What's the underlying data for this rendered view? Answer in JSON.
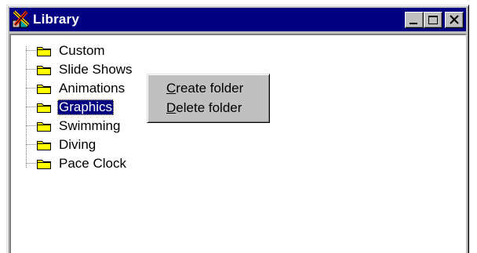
{
  "window": {
    "title": "Library",
    "app_icon": "library-app-icon",
    "buttons": [
      "minimize-icon",
      "maximize-icon",
      "close-icon"
    ]
  },
  "tree": {
    "items": [
      {
        "label": "Custom",
        "icon": "folder-icon",
        "selected": false
      },
      {
        "label": "Slide Shows",
        "icon": "folder-icon",
        "selected": false
      },
      {
        "label": "Animations",
        "icon": "folder-icon",
        "selected": false
      },
      {
        "label": "Graphics",
        "icon": "folder-icon",
        "selected": true
      },
      {
        "label": "Swimming",
        "icon": "folder-icon",
        "selected": false
      },
      {
        "label": "Diving",
        "icon": "folder-icon",
        "selected": false
      },
      {
        "label": "Pace Clock",
        "icon": "folder-icon",
        "selected": false
      }
    ]
  },
  "context_menu": {
    "items": [
      {
        "accel": "C",
        "rest": "reate folder"
      },
      {
        "accel": "D",
        "rest": "elete folder"
      }
    ]
  },
  "colors": {
    "titlebar": "#000080",
    "face": "#c0c0c0",
    "selection": "#000080",
    "folder": "#ffff00"
  }
}
